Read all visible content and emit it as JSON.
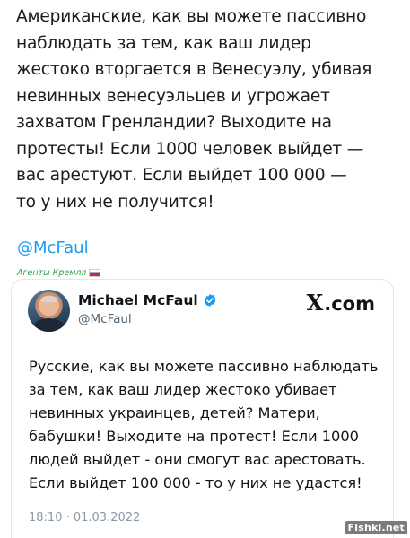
{
  "post": {
    "text_lines": [
      "Американские, как вы можете пассивно",
      "наблюдать за тем, как ваш лидер",
      "жестоко вторгается в Венесуэлу, убивая",
      "невинных венесуэльцев и угрожает",
      "захватом Гренландии? Выходите на",
      "протесты! Если 1000 человек выйдет —",
      "вас арестуют. Если выйдет 100 000 —",
      "то у них не получится!"
    ],
    "mention": "@McFaul",
    "caption": "Агенты Кремля"
  },
  "quoted_tweet": {
    "author_name": "Michael McFaul",
    "author_handle": "@McFaul",
    "brand": "X.com",
    "brand_x": "X",
    "brand_suffix": ".com",
    "text_lines": [
      "Русские, как вы можете пассивно наблюдать",
      "за тем, как ваш лидер жестоко убивает",
      "невинных украинцев, детей? Матери,",
      "бабушки! Выходите на протест! Если 1000",
      "людей выйдет - они смогут вас арестовать.",
      "Если выйдет 100 000 - то у них не удастся!"
    ],
    "timestamp": "18:10 · 01.03.2022",
    "icons": {
      "verified": "verified-badge-icon",
      "avatar": "profile-photo",
      "brand_logo": "x-logo-icon"
    },
    "verified_color": "#1d9bf0"
  },
  "watermark": "Fishki.net",
  "colors": {
    "link": "#1d9bf0",
    "caption_green": "#2f9e4a",
    "muted": "#536471"
  }
}
